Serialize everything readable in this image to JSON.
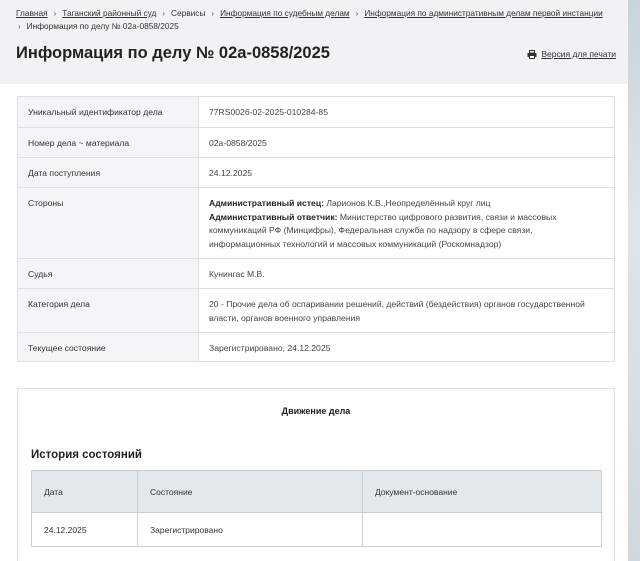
{
  "breadcrumb": {
    "items": [
      {
        "label": "Главная",
        "link": true
      },
      {
        "label": "Таганский районный суд",
        "link": true
      },
      {
        "label": "Сервисы",
        "link": false
      },
      {
        "label": "Информация по судебным делам",
        "link": true
      },
      {
        "label": "Информация по административным делам первой инстанции",
        "link": true
      }
    ],
    "current": "Информация по делу № 02а-0858/2025"
  },
  "header": {
    "title": "Информация по делу № 02а-0858/2025",
    "print_label": "Версия для печати"
  },
  "case_info": {
    "uid_label": "Уникальный идентификатор дела",
    "uid_value": "77RS0026-02-2025-010284-85",
    "number_label": "Номер дела ~ материала",
    "number_value": "02а-0858/2025",
    "date_label": "Дата поступления",
    "date_value": "24.12.2025",
    "parties_label": "Стороны",
    "plaintiff_role": "Административный истец:",
    "plaintiff_value": " Ларионов К.В.,Неопределённый круг лиц",
    "defendant_role": "Административный ответчик:",
    "defendant_value": " Министерство цифрового развития, связи и массовых коммуникаций РФ (Минцифры), Федеральная служба по надзору в сфере связи, информационных технологий и массовых коммуникаций (Роскомнадзор)",
    "judge_label": "Судья",
    "judge_value": "Кунингас М.В.",
    "category_label": "Категория дела",
    "category_value": "20 - Прочие дела об оспаривании решений, действий (бездействия) органов государственной власти, органов военного управления",
    "status_label": "Текущее состояние",
    "status_value": "Зарегистрировано, 24.12.2025"
  },
  "movement": {
    "title": "Движение дела",
    "history_title": "История состояний",
    "columns": [
      "Дата",
      "Состояние",
      "Документ-основание"
    ],
    "rows": [
      [
        "24.12.2025",
        "Зарегистрировано",
        ""
      ]
    ]
  },
  "colors": {
    "background": "#f0f2f3",
    "table_header": "#e3e8ec",
    "key_cell": "#f4f5f6"
  }
}
